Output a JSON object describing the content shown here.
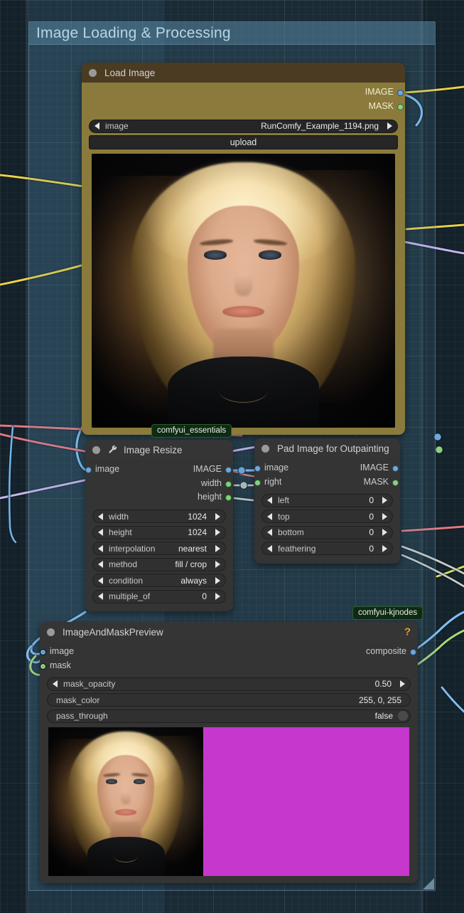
{
  "group": {
    "title": "Image Loading & Processing",
    "color": "#5a8caf"
  },
  "badges": {
    "essentials": "comfyui_essentials",
    "kjnodes": "comfyui-kjnodes"
  },
  "nodes": {
    "load_image": {
      "title": "Load Image",
      "outputs": [
        {
          "label": "IMAGE",
          "type": "IMAGE",
          "color": "#6ca8e0"
        },
        {
          "label": "MASK",
          "type": "MASK",
          "color": "#8dd086"
        }
      ],
      "widgets": [
        {
          "name": "image",
          "value": "RunComfy_Example_1194.png",
          "kind": "combo"
        }
      ],
      "button": "upload"
    },
    "image_resize": {
      "title": "Image Resize",
      "icon": "wrench-icon",
      "inputs": [
        {
          "label": "image",
          "type": "IMAGE",
          "color": "#6ca8e0"
        }
      ],
      "outputs": [
        {
          "label": "IMAGE",
          "type": "IMAGE",
          "color": "#6ca8e0"
        },
        {
          "label": "width",
          "type": "INT",
          "color": "#7ad67a"
        },
        {
          "label": "height",
          "type": "INT",
          "color": "#7ad67a"
        }
      ],
      "widgets": [
        {
          "name": "width",
          "value": "1024",
          "kind": "number"
        },
        {
          "name": "height",
          "value": "1024",
          "kind": "number"
        },
        {
          "name": "interpolation",
          "value": "nearest",
          "kind": "combo"
        },
        {
          "name": "method",
          "value": "fill / crop",
          "kind": "combo"
        },
        {
          "name": "condition",
          "value": "always",
          "kind": "combo"
        },
        {
          "name": "multiple_of",
          "value": "0",
          "kind": "number"
        }
      ]
    },
    "pad_image": {
      "title": "Pad Image for Outpainting",
      "inputs": [
        {
          "label": "image",
          "type": "IMAGE",
          "color": "#6ca8e0"
        },
        {
          "label": "right",
          "type": "INT",
          "color": "#7ad67a"
        }
      ],
      "outputs": [
        {
          "label": "IMAGE",
          "type": "IMAGE",
          "color": "#6ca8e0"
        },
        {
          "label": "MASK",
          "type": "MASK",
          "color": "#8dd086"
        }
      ],
      "widgets": [
        {
          "name": "left",
          "value": "0",
          "kind": "number"
        },
        {
          "name": "top",
          "value": "0",
          "kind": "number"
        },
        {
          "name": "bottom",
          "value": "0",
          "kind": "number"
        },
        {
          "name": "feathering",
          "value": "0",
          "kind": "number"
        }
      ]
    },
    "image_and_mask_preview": {
      "title": "ImageAndMaskPreview",
      "help": "?",
      "inputs": [
        {
          "label": "image",
          "type": "IMAGE",
          "color": "#6ca8e0"
        },
        {
          "label": "mask",
          "type": "MASK",
          "color": "#8dd086"
        }
      ],
      "outputs": [
        {
          "label": "composite",
          "type": "IMAGE",
          "color": "#6ca8e0"
        }
      ],
      "widgets": [
        {
          "name": "mask_opacity",
          "value": "0.50",
          "kind": "number"
        },
        {
          "name": "mask_color",
          "value": "255, 0, 255",
          "kind": "text"
        },
        {
          "name": "pass_through",
          "value": "false",
          "kind": "toggle"
        }
      ],
      "preview": {
        "mask_fill": "#c637cd"
      }
    }
  }
}
